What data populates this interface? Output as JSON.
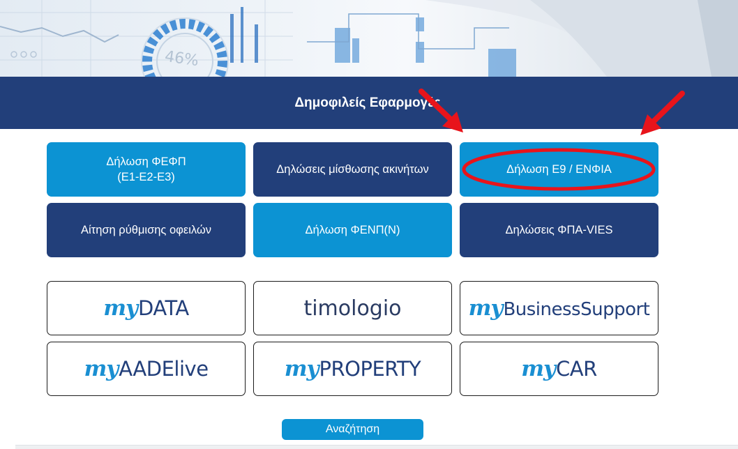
{
  "hero": {
    "gauge_text": "46%"
  },
  "section": {
    "title": "Δημοφιλείς Εφαρμογές"
  },
  "tiles": [
    {
      "label": "Δήλωση ΦΕΦΠ\n(Ε1-Ε2-Ε3)",
      "style": "light"
    },
    {
      "label": "Δηλώσεις μίσθωσης ακινήτων",
      "style": "dark"
    },
    {
      "label": "Δήλωση Ε9 / ΕΝΦΙΑ",
      "style": "light"
    },
    {
      "label": "Αίτηση ρύθμισης οφειλών",
      "style": "dark"
    },
    {
      "label": "Δήλωση ΦΕΝΠ(Ν)",
      "style": "light"
    },
    {
      "label": "Δηλώσεις ΦΠΑ-VIES",
      "style": "dark"
    }
  ],
  "logos": {
    "mydata": {
      "prefix": "my",
      "rest": "DATA"
    },
    "timologio": {
      "rest": "timologio"
    },
    "mybusinesssupport": {
      "prefix": "my",
      "rest": "BusinessSupport"
    },
    "myaadelive": {
      "prefix": "my",
      "rest": "AADElive"
    },
    "myproperty": {
      "prefix": "my",
      "rest": "PROPERTY"
    },
    "mycar": {
      "prefix": "my",
      "rest": "CAR"
    }
  },
  "search": {
    "label": "Αναζήτηση"
  },
  "colors": {
    "navy": "#223f7a",
    "blue": "#0c93d3",
    "annotation_red": "#e8141b"
  }
}
